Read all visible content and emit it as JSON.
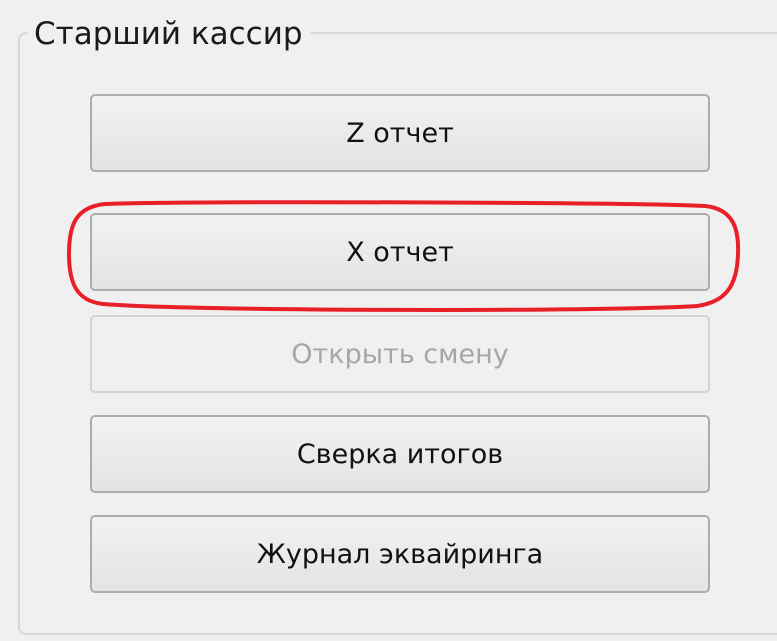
{
  "group": {
    "title": "Старший кассир"
  },
  "buttons": {
    "z_report": "Z отчет",
    "x_report": "X отчет",
    "open_shift": "Открыть смену",
    "reconcile_totals": "Сверка итогов",
    "acquiring_journal": "Журнал эквайринга"
  },
  "states": {
    "open_shift_enabled": false
  },
  "colors": {
    "background": "#f0f0f0",
    "highlight": "#e8202a",
    "disabled_text": "#a6a6a6"
  }
}
